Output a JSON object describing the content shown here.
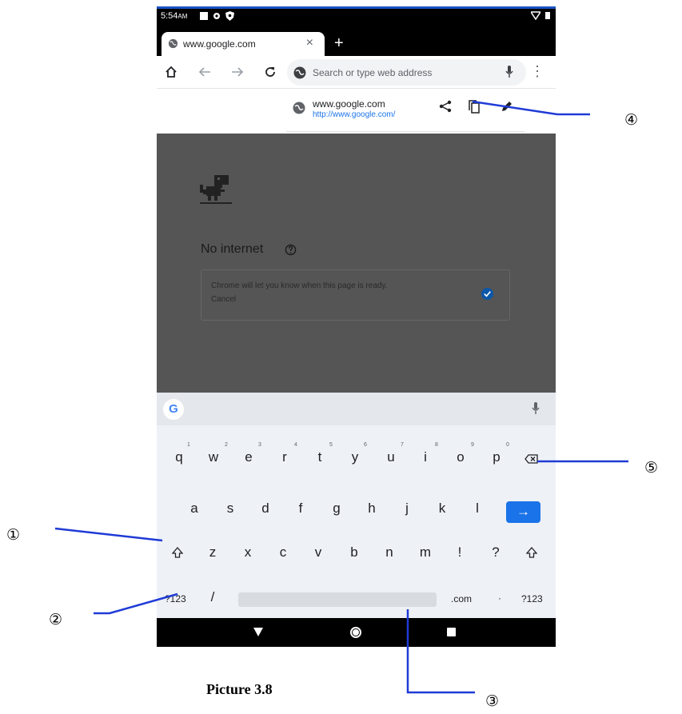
{
  "status_bar": {
    "time": "5:54",
    "ampm": "AM"
  },
  "tab": {
    "title": "www.google.com",
    "close": "×"
  },
  "new_tab": "+",
  "toolbar": {
    "home_icon": "home-icon",
    "back_icon": "back-arrow-icon",
    "forward_icon": "forward-arrow-icon",
    "reload_icon": "reload-icon",
    "menu": "⋮"
  },
  "omnibox": {
    "placeholder": "Search or type web address"
  },
  "suggestion": {
    "title": "www.google.com",
    "url": "http://www.google.com/"
  },
  "error_page": {
    "heading": "No internet",
    "notify_text": "Chrome will let you know when this page is ready.",
    "cancel": "Cancel"
  },
  "keyboard": {
    "row1": [
      "q",
      "w",
      "e",
      "r",
      "t",
      "y",
      "u",
      "i",
      "o",
      "p"
    ],
    "row1_hints": [
      "1",
      "2",
      "3",
      "4",
      "5",
      "6",
      "7",
      "8",
      "9",
      "0"
    ],
    "row2": [
      "a",
      "s",
      "d",
      "f",
      "g",
      "h",
      "j",
      "k",
      "l"
    ],
    "row3": [
      "z",
      "x",
      "c",
      "v",
      "b",
      "n",
      "m",
      "!",
      "?"
    ],
    "symbols_left": "?123",
    "slash": "/",
    "dotcom": ".com",
    "dot": "·",
    "symbols_right": "?123",
    "enter": "→"
  },
  "callouts": {
    "one": "①",
    "two": "②",
    "three": "③",
    "four": "④",
    "five": "⑤"
  },
  "caption": "Picture 3.8",
  "colors": {
    "accent": "#1a73e8",
    "annotation_line": "#1f3bd6",
    "page_dim": "#555555"
  }
}
